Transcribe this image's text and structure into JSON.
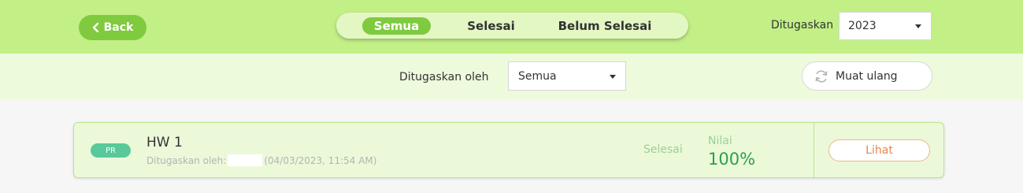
{
  "header": {
    "back_label": "Back",
    "tabs": [
      {
        "label": "Semua",
        "active": true
      },
      {
        "label": "Selesai",
        "active": false
      },
      {
        "label": "Belum Selesai",
        "active": false
      }
    ],
    "assigned_label": "Ditugaskan",
    "year_value": "2023"
  },
  "filters": {
    "assigned_by_label": "Ditugaskan oleh",
    "assigned_by_value": "Semua",
    "reload_label": "Muat ulang"
  },
  "assignments": [
    {
      "type": "PR",
      "title": "HW 1",
      "assigned_by_prefix": "Ditugaskan oleh:",
      "assigned_date": "(04/03/2023, 11:54 AM)",
      "status": "Selesai",
      "grade_label": "Nilai",
      "grade_value": "100%",
      "view_label": "Lihat"
    }
  ],
  "colors": {
    "topbar": "#c2ef86",
    "accent": "#7fca3e",
    "filterbar": "#edfadc",
    "card": "#ebf9d9",
    "badge": "#58c99b",
    "grade": "#2ba04d",
    "view_button": "#e8854b"
  },
  "icons": {
    "back": "chevron-left-icon",
    "reload": "refresh-icon",
    "dropdown": "caret-down-icon"
  }
}
